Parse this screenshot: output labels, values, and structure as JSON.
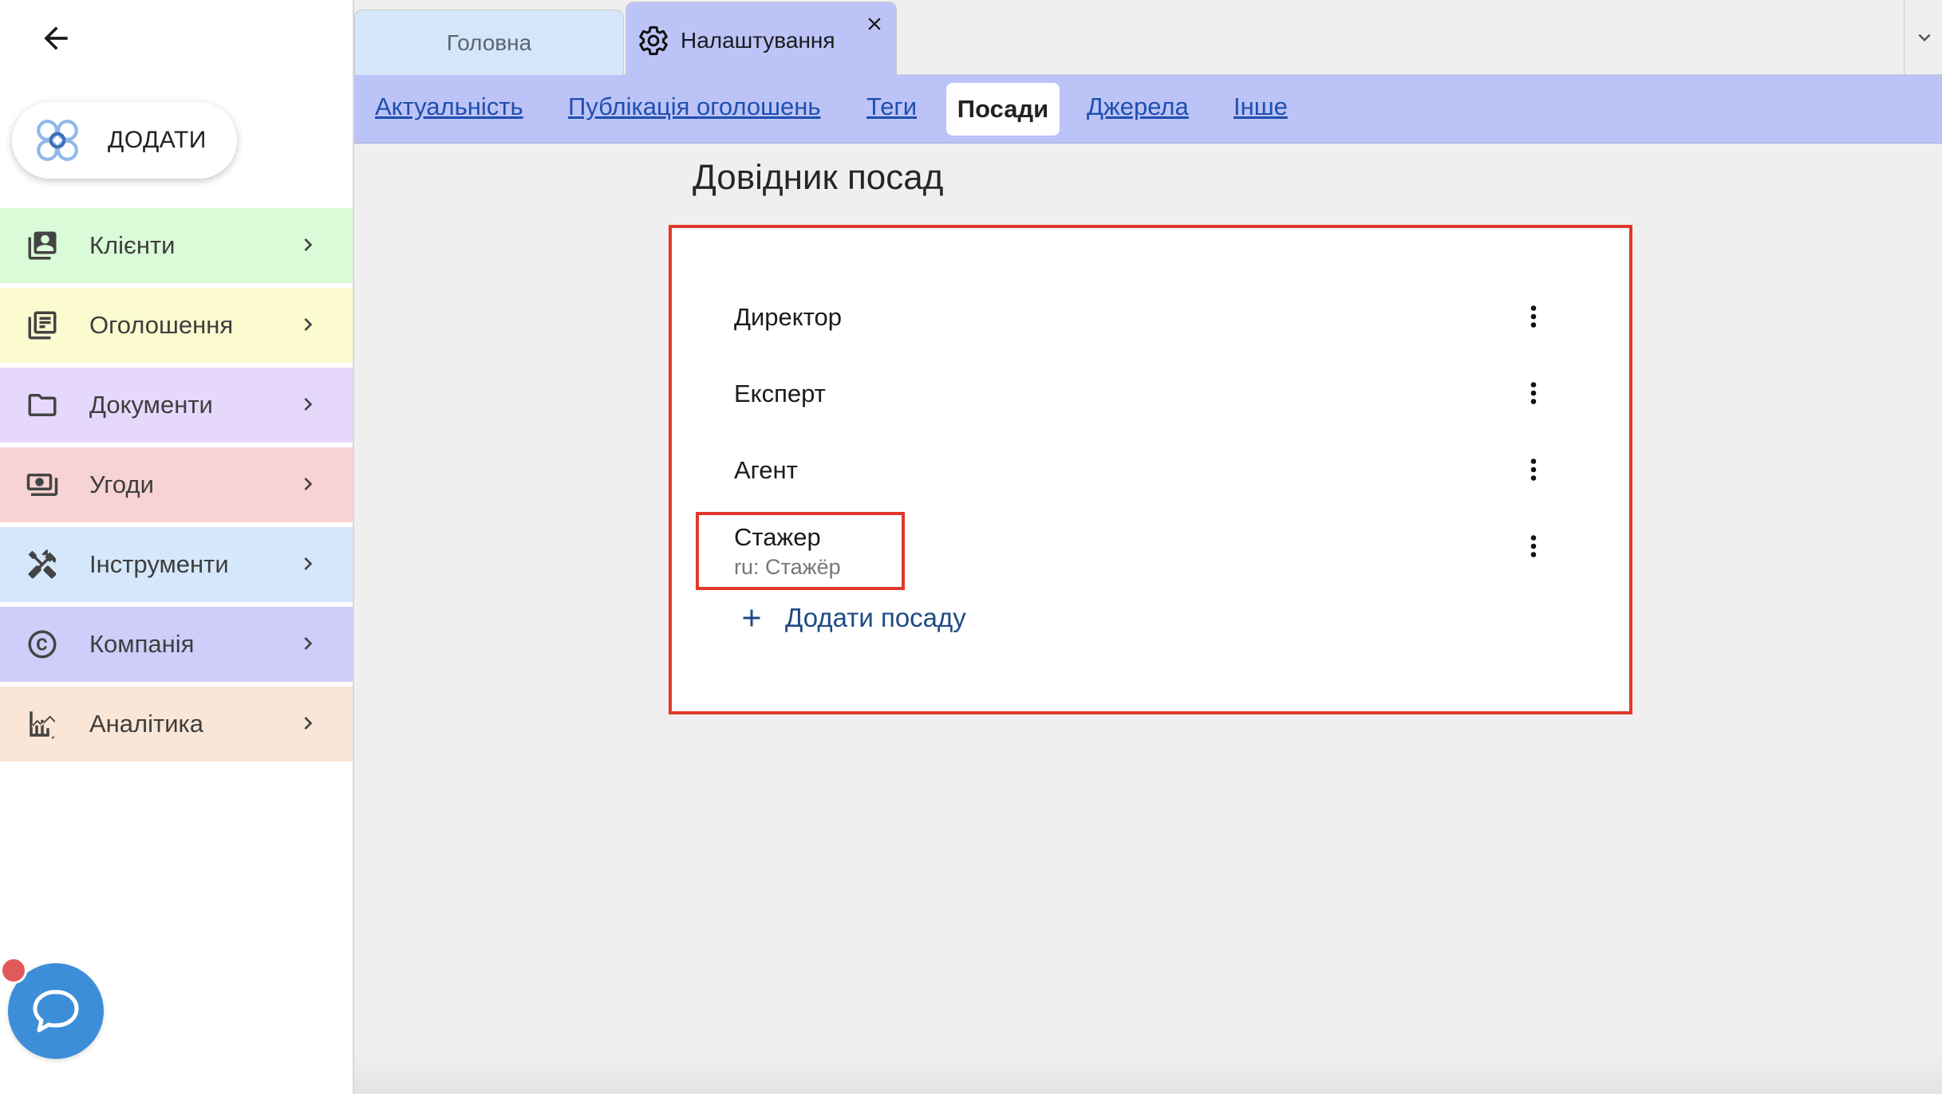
{
  "sidebar": {
    "add_button_label": "ДОДАТИ",
    "menu": [
      {
        "label": "Клієнти",
        "icon": "contacts-icon",
        "bg": "#d9fbd7"
      },
      {
        "label": "Оголошення",
        "icon": "listings-icon",
        "bg": "#fbfbcf"
      },
      {
        "label": "Документи",
        "icon": "folder-icon",
        "bg": "#e6d8fb"
      },
      {
        "label": "Угоди",
        "icon": "money-icon",
        "bg": "#f8d3d3"
      },
      {
        "label": "Інструменти",
        "icon": "tools-icon",
        "bg": "#d5e8fb"
      },
      {
        "label": "Компанія",
        "icon": "copyright-icon",
        "bg": "#cfcdf9"
      },
      {
        "label": "Аналітика",
        "icon": "analytics-icon",
        "bg": "#fae6d6"
      }
    ]
  },
  "tabs": {
    "home": "Головна",
    "settings": "Налаштування"
  },
  "subnav": {
    "items": [
      "Актуальність",
      "Публікація оголошень",
      "Теги",
      "Посади",
      "Джерела",
      "Інше"
    ],
    "active": "Посади"
  },
  "page": {
    "title": "Довідник посад",
    "positions": [
      {
        "name": "Директор"
      },
      {
        "name": "Експерт"
      },
      {
        "name": "Агент"
      },
      {
        "name": "Стажер",
        "sub": "ru: Стажёр"
      }
    ],
    "add_label": "Додати посаду"
  },
  "colors": {
    "accent": "#bcc3f7",
    "highlight": "#e0392b",
    "link": "#1f4fb0",
    "chat": "#3d8ed8"
  }
}
